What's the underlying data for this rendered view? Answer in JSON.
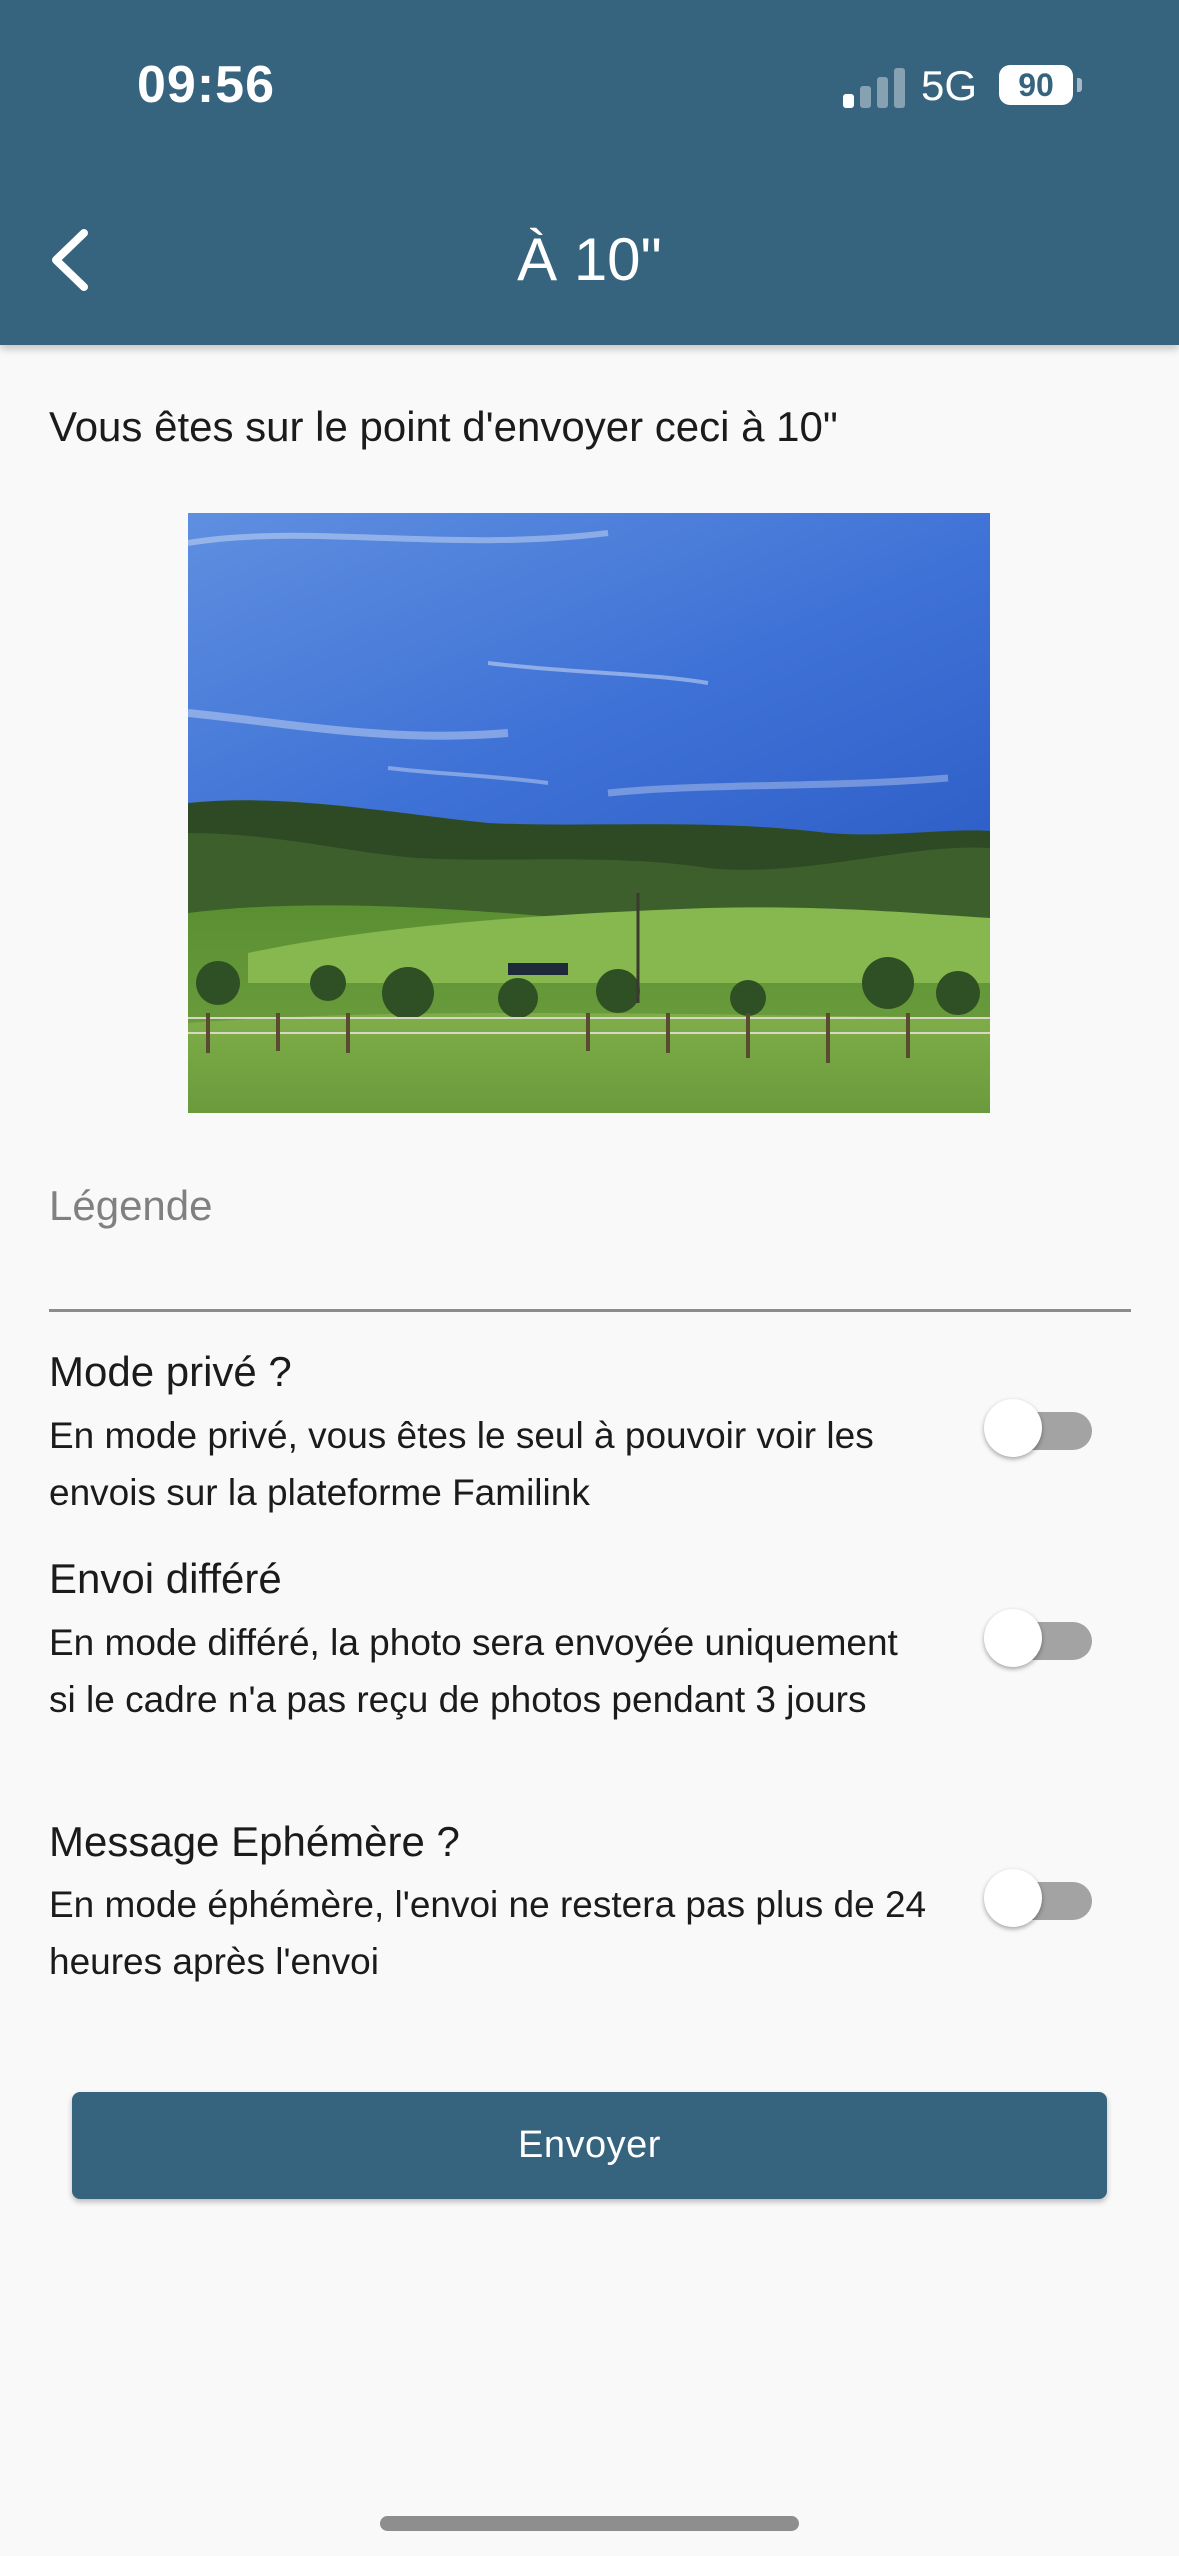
{
  "status_bar": {
    "time": "09:56",
    "network": "5G",
    "battery": "90",
    "signal_bars_active": 1,
    "signal_bars_total": 4
  },
  "header": {
    "title": "À 10\"",
    "back_icon": "chevron-left-icon",
    "background": "#36647f"
  },
  "intro_text": "Vous êtes sur le point d'envoyer ceci à 10\"",
  "caption": {
    "placeholder": "Légende",
    "value": ""
  },
  "options": [
    {
      "title": "Mode privé ?",
      "description": "En mode privé, vous êtes le seul à pouvoir voir les envois sur la plateforme Familink",
      "enabled": false
    },
    {
      "title": "Envoi différé",
      "description": "En mode différé, la photo sera envoyée uniquement si le cadre n'a pas reçu de photos pendant 3 jours",
      "enabled": false
    },
    {
      "title": "Message Ephémère ?",
      "description": "En mode éphémère, l'envoi ne restera pas plus de 24 heures après l'envoi",
      "enabled": false
    }
  ],
  "send_button": {
    "label": "Envoyer",
    "color": "#36647f"
  }
}
